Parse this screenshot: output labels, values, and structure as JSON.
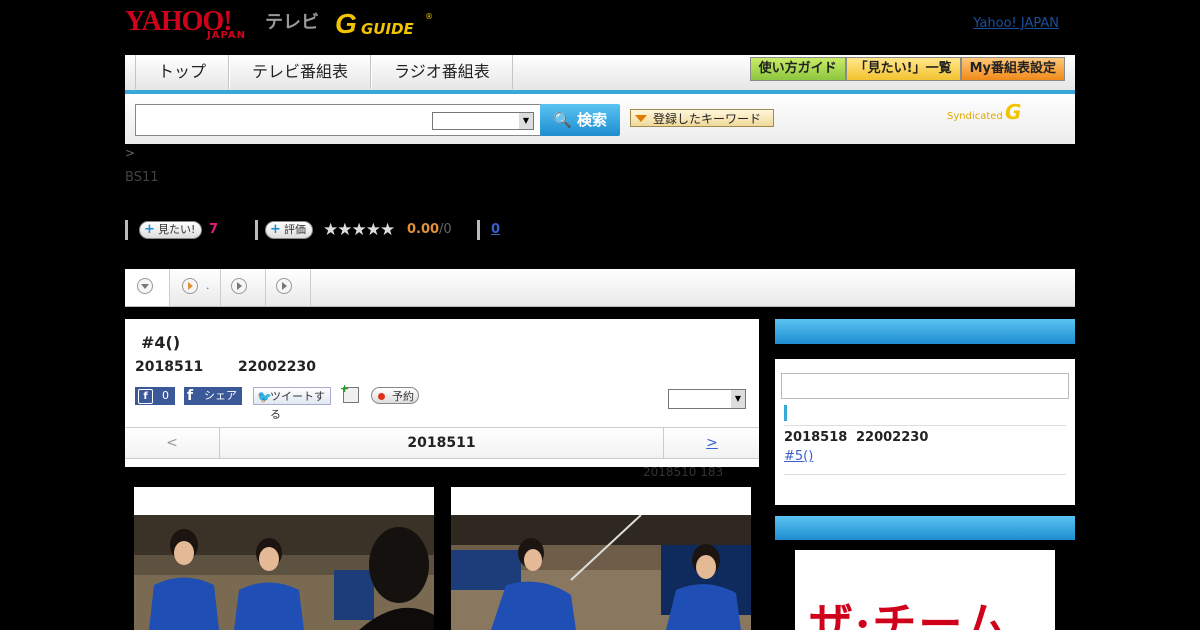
{
  "header": {
    "logo_yahoo": "YAHOO!",
    "logo_japan": "JAPAN",
    "logo_tv": "テレビ",
    "logo_gguide": "G GUIDE",
    "yahoo_japan_link": "Yahoo! JAPAN"
  },
  "nav": {
    "tabs": [
      "トップ",
      "テレビ番組表",
      "ラジオ番組表"
    ],
    "right_buttons": [
      "使い方ガイド",
      "「見たい!」一覧",
      "My番組表設定"
    ]
  },
  "search": {
    "button_label": "検索",
    "keyword_button": "登録したキーワード",
    "syndicated": "Syndicated"
  },
  "breadcrumb": ">",
  "channel": "BS11",
  "rating": {
    "want_label": "見たい!",
    "want_count": "7",
    "rate_label": "評価",
    "stars": "★★★★★",
    "score": "0.00",
    "score_total": "/0",
    "review_count": "0"
  },
  "subtabs": [
    ".",
    "",
    ""
  ],
  "program": {
    "title": "#4()",
    "date": "2018511",
    "time": "22002230",
    "fb_count": "0",
    "share_label": "シェア",
    "tweet_label": "ツイートする",
    "reserve_label": "予約"
  },
  "date_nav": {
    "prev": "<",
    "current": "2018511",
    "next": ">"
  },
  "update_note": "2018510  183",
  "next_episode": {
    "date": "2018518",
    "time": "22002230",
    "title": "#5()"
  },
  "banner_text": "ザ·チーム"
}
